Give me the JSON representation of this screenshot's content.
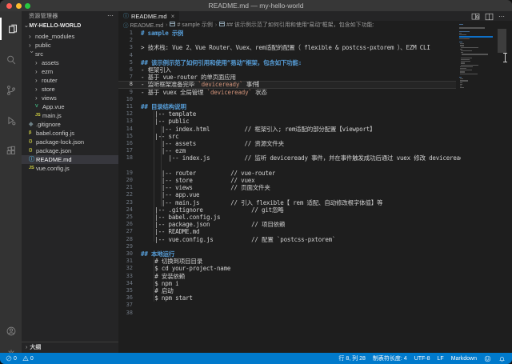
{
  "window": {
    "title": "README.md — my-hello-world"
  },
  "activity_bar": {
    "items": [
      {
        "name": "explorer",
        "active": true
      },
      {
        "name": "search",
        "active": false
      },
      {
        "name": "source-control",
        "active": false
      },
      {
        "name": "run-and-debug",
        "active": false
      },
      {
        "name": "extensions",
        "active": false
      }
    ],
    "bottom": [
      {
        "name": "account"
      },
      {
        "name": "settings"
      }
    ]
  },
  "sidebar": {
    "title": "资源管理器",
    "more": "⋯",
    "section": "MY-HELLO-WORLD",
    "outline": "大纲",
    "tree": [
      {
        "label": "node_modules",
        "kind": "folder",
        "depth": 0,
        "expanded": false
      },
      {
        "label": "public",
        "kind": "folder",
        "depth": 0,
        "expanded": false
      },
      {
        "label": "src",
        "kind": "folder",
        "depth": 0,
        "expanded": true
      },
      {
        "label": "assets",
        "kind": "folder",
        "depth": 1,
        "expanded": false
      },
      {
        "label": "ezm",
        "kind": "folder",
        "depth": 1,
        "expanded": false
      },
      {
        "label": "router",
        "kind": "folder",
        "depth": 1,
        "expanded": false
      },
      {
        "label": "store",
        "kind": "folder",
        "depth": 1,
        "expanded": false
      },
      {
        "label": "views",
        "kind": "folder",
        "depth": 1,
        "expanded": false
      },
      {
        "label": "App.vue",
        "kind": "file",
        "icon": "vue-icon",
        "glyph": "V",
        "color": "#41b883",
        "depth": 1
      },
      {
        "label": "main.js",
        "kind": "file",
        "icon": "js-icon",
        "glyph": "JS",
        "color": "#cbcb41",
        "depth": 1
      },
      {
        "label": ".gitignore",
        "kind": "file",
        "icon": "git-icon",
        "glyph": "◆",
        "color": "#6d8086",
        "depth": 0
      },
      {
        "label": "babel.config.js",
        "kind": "file",
        "icon": "babel-icon",
        "glyph": "β",
        "color": "#cbcb41",
        "depth": 0
      },
      {
        "label": "package-lock.json",
        "kind": "file",
        "icon": "json-icon",
        "glyph": "{}",
        "color": "#cbcb41",
        "depth": 0
      },
      {
        "label": "package.json",
        "kind": "file",
        "icon": "json-icon",
        "glyph": "{}",
        "color": "#cbcb41",
        "depth": 0
      },
      {
        "label": "README.md",
        "kind": "file",
        "icon": "info-icon",
        "glyph": "ⓘ",
        "color": "#519aba",
        "depth": 0,
        "selected": true
      },
      {
        "label": "vue.config.js",
        "kind": "file",
        "icon": "js-icon",
        "glyph": "JS",
        "color": "#cbcb41",
        "depth": 0
      }
    ]
  },
  "editor": {
    "tab": {
      "icon": "ⓘ",
      "label": "README.md",
      "close": "×"
    },
    "actions_more": "⋯",
    "breadcrumb": [
      {
        "icon": "info",
        "label": "README.md"
      },
      {
        "icon": "section",
        "label": "# sample 示例"
      },
      {
        "icon": "section",
        "label": "## 该示例示范了如何引用和使用“易动”框架，包含如下功能:"
      }
    ],
    "lines": [
      {
        "n": 1,
        "parts": [
          [
            "h",
            "# sample 示例"
          ]
        ]
      },
      {
        "n": 2,
        "parts": []
      },
      {
        "n": 3,
        "parts": [
          [
            "t",
            "> 技术栈: Vue 2、Vue Router、Vuex、rem适配的配置（ flexible & postcss-pxtorem ）、EZM CLI"
          ]
        ]
      },
      {
        "n": 4,
        "parts": []
      },
      {
        "n": 5,
        "parts": [
          [
            "h",
            "## 该示例示范了如何引用和使用“易动”框架，包含如下功能:"
          ]
        ]
      },
      {
        "n": 6,
        "parts": [
          [
            "t",
            "- 框架引入"
          ]
        ]
      },
      {
        "n": 7,
        "parts": [
          [
            "t",
            "- 基于 vue-router 的单页面应用"
          ]
        ]
      },
      {
        "n": 8,
        "parts": [
          [
            "t",
            "- 监听框架准备完毕 "
          ],
          [
            "o",
            "`deviceready`"
          ],
          [
            "t",
            " 事件"
          ]
        ],
        "cursor": true
      },
      {
        "n": 9,
        "parts": [
          [
            "t",
            "- 基于 vuex 全局管理 "
          ],
          [
            "o",
            "`deviceready`"
          ],
          [
            "t",
            " 状态"
          ]
        ]
      },
      {
        "n": 10,
        "parts": []
      },
      {
        "n": 11,
        "parts": [
          [
            "h",
            "## 目录结构说明"
          ]
        ]
      },
      {
        "n": 12,
        "parts": [
          [
            "t",
            "    |-- template"
          ]
        ]
      },
      {
        "n": 13,
        "parts": [
          [
            "t",
            "    |-- public"
          ]
        ]
      },
      {
        "n": 14,
        "parts": [
          [
            "t",
            "      |-- index.html          // 框架引入; rem适配的部分配置【viewport】"
          ]
        ]
      },
      {
        "n": 15,
        "parts": [
          [
            "t",
            "    |-- src"
          ]
        ]
      },
      {
        "n": 16,
        "parts": [
          [
            "t",
            "      |-- assets              // 资源文件夹"
          ]
        ]
      },
      {
        "n": 17,
        "parts": [
          [
            "t",
            "      |-- ezm"
          ]
        ]
      },
      {
        "n": 18,
        "parts": [
          [
            "t",
            "        |-- index.js          // 监听 deviceready 事件，并在事件触发成功后通过 vuex 修改 deviceready 状态值"
          ]
        ]
      },
      {
        "n": null,
        "parts": []
      },
      {
        "n": 19,
        "parts": [
          [
            "t",
            "      |-- router          // vue-router"
          ]
        ]
      },
      {
        "n": 20,
        "parts": [
          [
            "t",
            "      |-- store           // vuex"
          ]
        ]
      },
      {
        "n": 21,
        "parts": [
          [
            "t",
            "      |-- views           // 页面文件夹"
          ]
        ]
      },
      {
        "n": 22,
        "parts": [
          [
            "t",
            "      |-- app.vue"
          ]
        ]
      },
      {
        "n": 23,
        "parts": [
          [
            "t",
            "      |-- main.js         // 引入 flexible【 rem 适配、自动修改根字体值】等"
          ]
        ]
      },
      {
        "n": 24,
        "parts": [
          [
            "t",
            "    |-- .gitignore              // git忽略"
          ]
        ]
      },
      {
        "n": 25,
        "parts": [
          [
            "t",
            "    |-- babel.config.js"
          ]
        ]
      },
      {
        "n": 26,
        "parts": [
          [
            "t",
            "    |-- package.json            // 项目依赖"
          ]
        ]
      },
      {
        "n": 27,
        "parts": [
          [
            "t",
            "    |-- README.md"
          ]
        ]
      },
      {
        "n": 28,
        "parts": [
          [
            "t",
            "    |-- vue.config.js           // 配置 `postcss-pxtorem`"
          ]
        ]
      },
      {
        "n": 29,
        "parts": []
      },
      {
        "n": 30,
        "parts": [
          [
            "h",
            "## 本地运行"
          ]
        ]
      },
      {
        "n": 31,
        "parts": [
          [
            "t",
            "    # 切换到项目目录"
          ]
        ]
      },
      {
        "n": 32,
        "parts": [
          [
            "t",
            "    $ cd your-project-name"
          ]
        ]
      },
      {
        "n": 33,
        "parts": [
          [
            "t",
            "    # 安装依赖"
          ]
        ]
      },
      {
        "n": 34,
        "parts": [
          [
            "t",
            "    $ npm i"
          ]
        ]
      },
      {
        "n": 35,
        "parts": [
          [
            "t",
            "    # 启动"
          ]
        ]
      },
      {
        "n": 36,
        "parts": [
          [
            "t",
            "    $ npm start"
          ]
        ]
      },
      {
        "n": 37,
        "parts": []
      },
      {
        "n": 38,
        "parts": []
      }
    ]
  },
  "status_bar": {
    "errors": "0",
    "warnings": "0",
    "cursor": "行 8, 列 28",
    "tabsize": "制表符长度: 4",
    "encoding": "UTF-8",
    "eol": "LF",
    "language": "Markdown"
  },
  "colors": {
    "accent": "#007acc",
    "heading": "#569cd6",
    "inline_code": "#ce9178",
    "vue": "#41b883",
    "yellow": "#cbcb41",
    "readme_info": "#519aba",
    "muted_icon": "#6d8086"
  }
}
